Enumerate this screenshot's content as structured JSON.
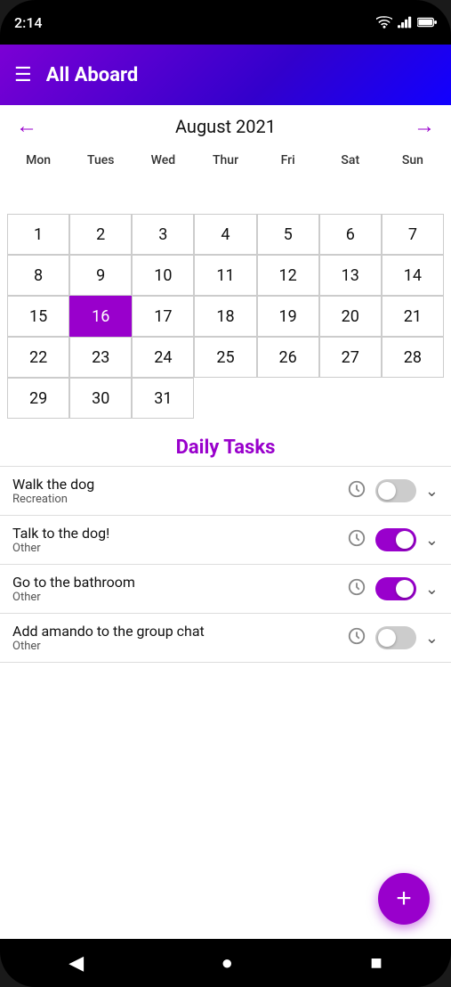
{
  "statusBar": {
    "time": "2:14",
    "icons": [
      "wifi",
      "signal",
      "battery"
    ]
  },
  "topBar": {
    "menuIcon": "☰",
    "title": "All Aboard"
  },
  "calendar": {
    "monthYear": "August 2021",
    "prevIcon": "←",
    "nextIcon": "→",
    "dayHeaders": [
      "Mon",
      "Tues",
      "Wed",
      "Thur",
      "Fri",
      "Sat",
      "Sun"
    ],
    "weeks": [
      [
        "",
        "",
        "",
        "",
        "",
        "",
        ""
      ],
      [
        "1",
        "2",
        "3",
        "4",
        "5",
        "6",
        "7"
      ],
      [
        "8",
        "9",
        "10",
        "11",
        "12",
        "13",
        "14"
      ],
      [
        "15",
        "16",
        "17",
        "18",
        "19",
        "20",
        "21"
      ],
      [
        "22",
        "23",
        "24",
        "25",
        "26",
        "27",
        "28"
      ],
      [
        "29",
        "30",
        "31",
        "",
        "",
        "",
        ""
      ]
    ],
    "selectedDay": "16"
  },
  "tasksSection": {
    "title": "Daily Tasks",
    "tasks": [
      {
        "name": "Walk the dog",
        "category": "Recreation",
        "toggled": false,
        "alarmIcon": "⏰"
      },
      {
        "name": "Talk to the dog!",
        "category": "Other",
        "toggled": true,
        "alarmIcon": "⏰"
      },
      {
        "name": "Go to the bathroom",
        "category": "Other",
        "toggled": true,
        "alarmIcon": "⏰"
      },
      {
        "name": "Add amando to the group chat",
        "category": "Other",
        "toggled": false,
        "alarmIcon": "⏰"
      }
    ]
  },
  "fab": {
    "label": "+"
  },
  "bottomNav": {
    "back": "◀",
    "home": "●",
    "square": "■"
  }
}
